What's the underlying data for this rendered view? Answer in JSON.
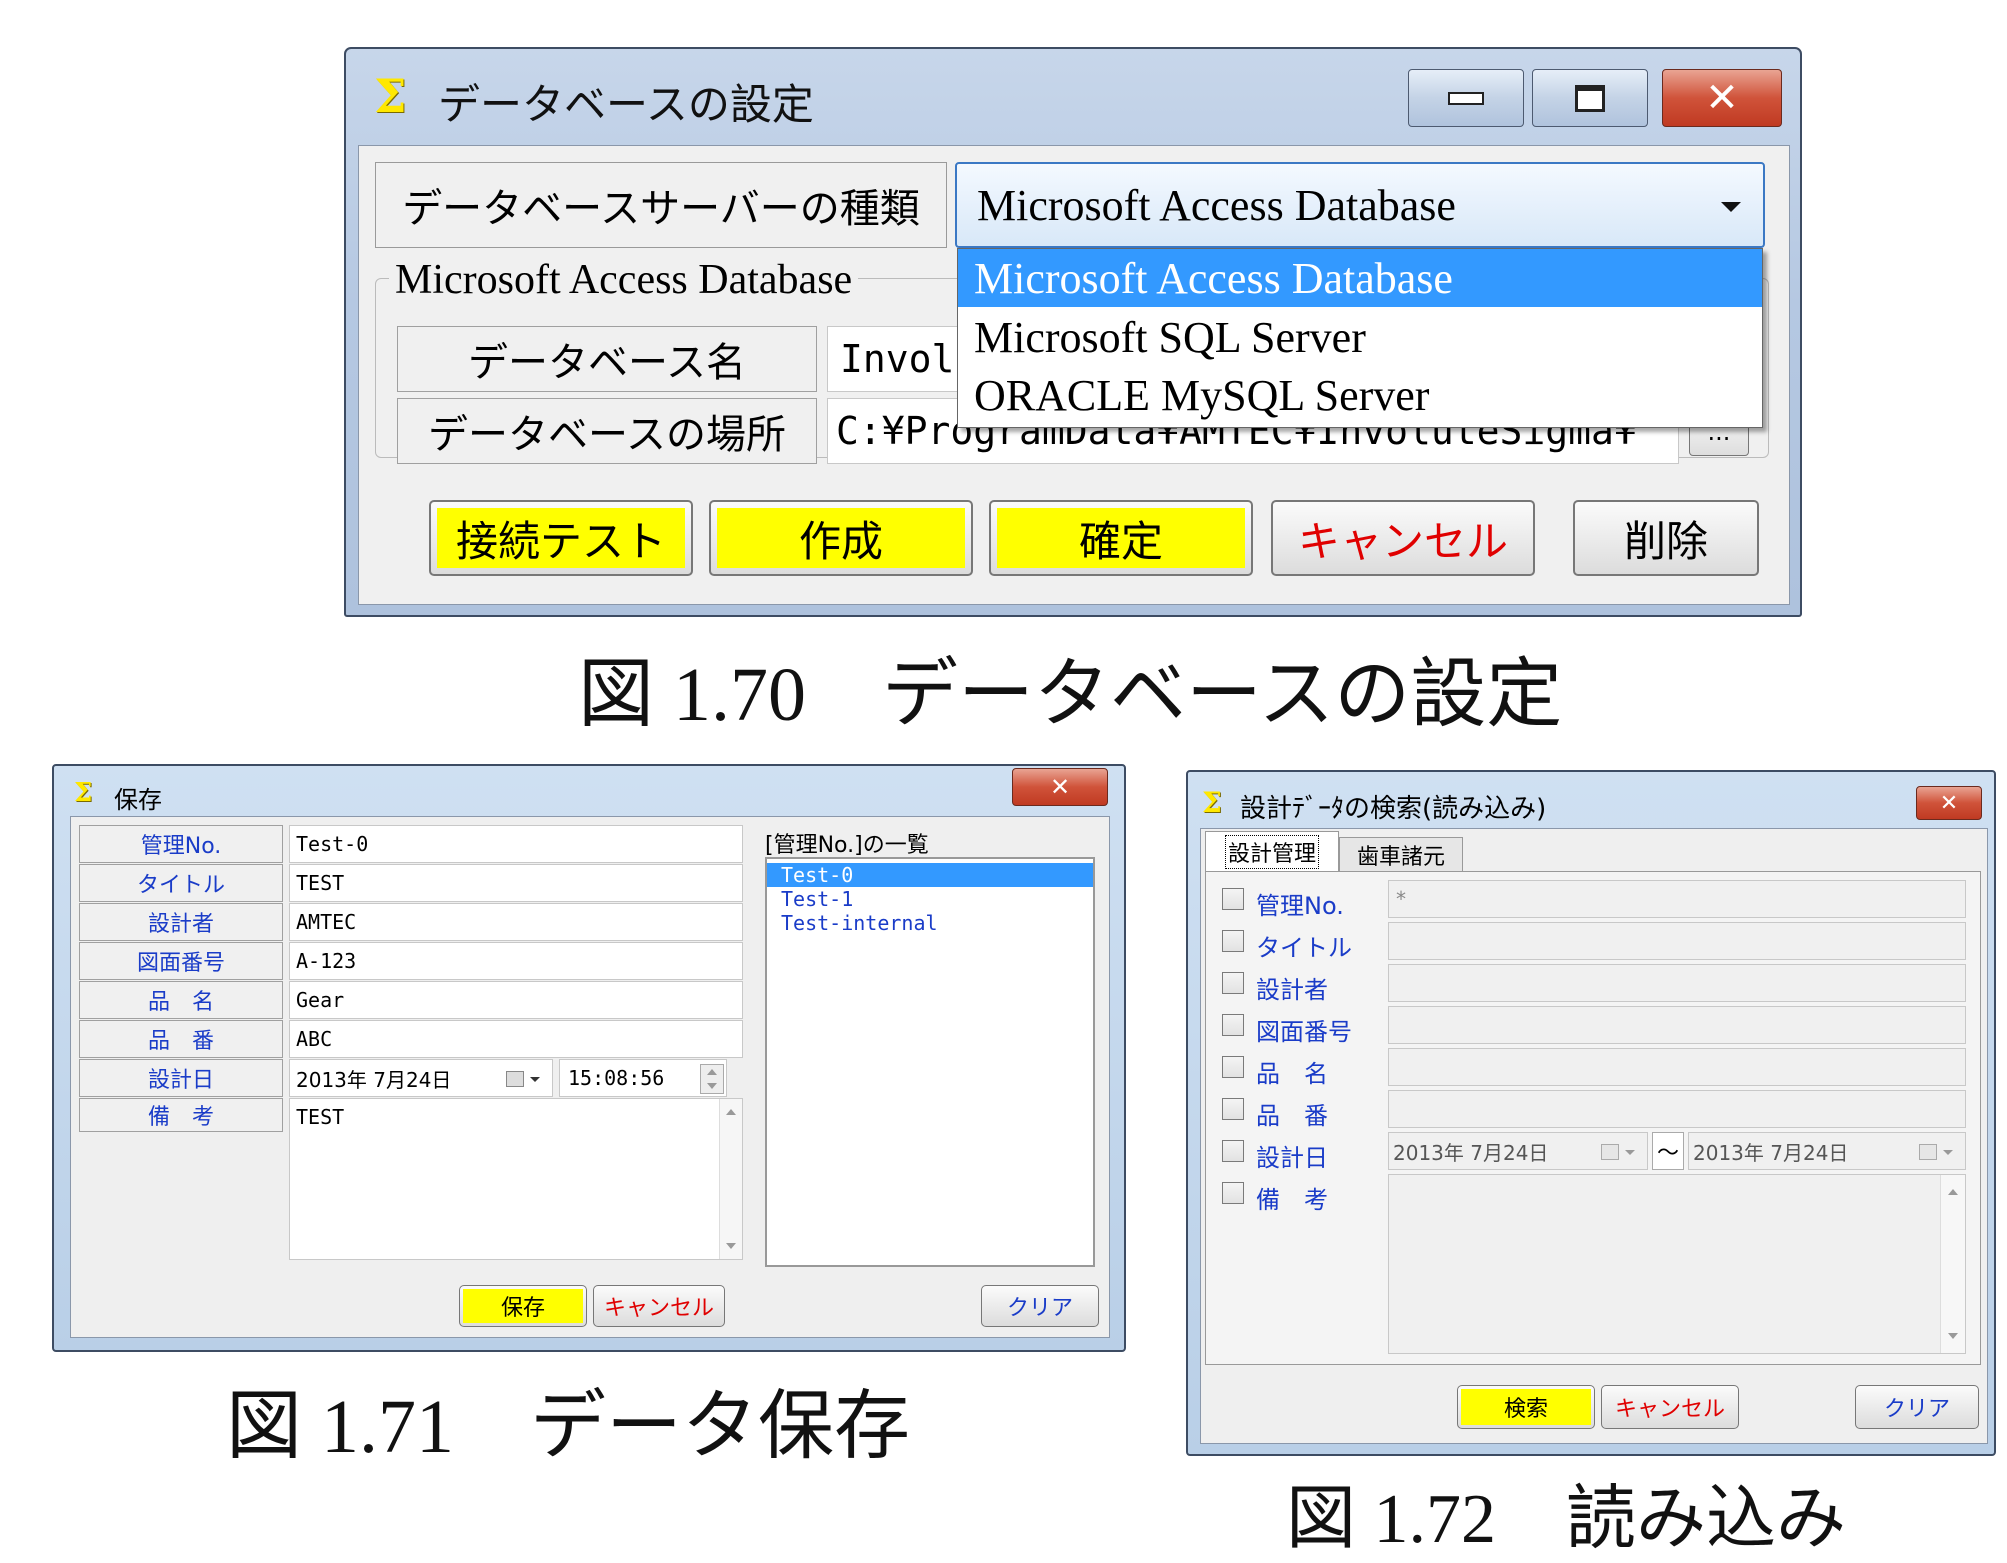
{
  "fig70": {
    "window_title": "データベースの設定",
    "server_type_label": "データベースサーバーの種類",
    "server_type_value": "Microsoft Access Database",
    "dropdown_options": [
      "Microsoft Access Database",
      "Microsoft SQL Server",
      "ORACLE MySQL Server"
    ],
    "group_label": "Microsoft Access Database",
    "db_name_label": "データベース名",
    "db_name_value": "Invol",
    "db_location_label": "データベースの場所",
    "db_location_value": "C:¥ProgramData¥AMTEC¥InvoluteSigma¥",
    "browse_label": "...",
    "buttons": {
      "test": "接続テスト",
      "create": "作成",
      "confirm": "確定",
      "cancel": "キャンセル",
      "delete": "削除"
    },
    "caption": "図 1.70　データベースの設定"
  },
  "fig71": {
    "window_title": "保存",
    "labels": [
      "管理No.",
      "タイトル",
      "設計者",
      "図面番号",
      "品　名",
      "品　番",
      "設計日",
      "備　考"
    ],
    "values": {
      "kanri": "Test-0",
      "title": "TEST",
      "designer": "AMTEC",
      "drawing_no": "A-123",
      "product_name": "Gear",
      "product_no": "ABC",
      "date": "2013年 7月24日",
      "time": "15:08:56",
      "remarks": "TEST"
    },
    "list_header": "[管理No.]の一覧",
    "list_items": [
      "Test-0",
      "Test-1",
      "Test-internal"
    ],
    "buttons": {
      "save": "保存",
      "cancel": "キャンセル",
      "clear": "クリア"
    },
    "caption": "図 1.71　データ保存"
  },
  "fig72": {
    "window_title": "設計ﾃﾞｰﾀの検索(読み込み)",
    "tabs": [
      "設計管理",
      "歯車諸元"
    ],
    "labels": [
      "管理No.",
      "タイトル",
      "設計者",
      "図面番号",
      "品　名",
      "品　番",
      "設計日",
      "備　考"
    ],
    "kanri_value": "*",
    "date_from": "2013年 7月24日",
    "date_sep": "〜",
    "date_to": "2013年 7月24日",
    "buttons": {
      "search": "検索",
      "cancel": "キャンセル",
      "clear": "クリア"
    },
    "caption": "図 1.72　読み込み"
  }
}
